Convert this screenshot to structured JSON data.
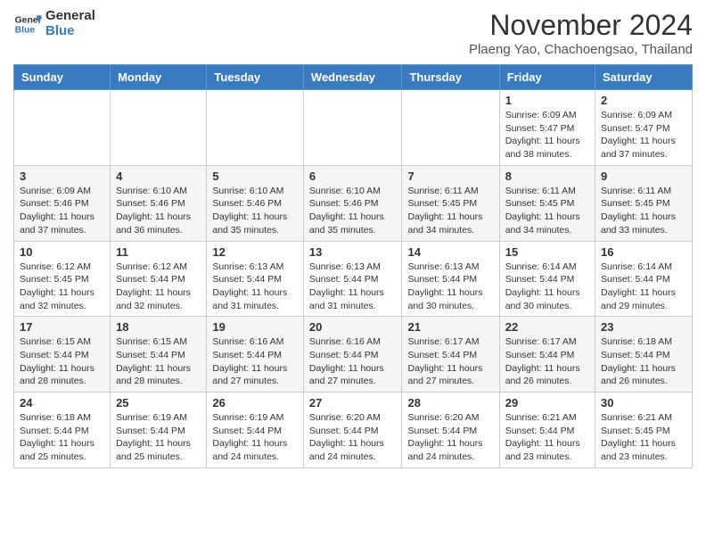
{
  "header": {
    "logo_line1": "General",
    "logo_line2": "Blue",
    "month": "November 2024",
    "location": "Plaeng Yao, Chachoengsao, Thailand"
  },
  "weekdays": [
    "Sunday",
    "Monday",
    "Tuesday",
    "Wednesday",
    "Thursday",
    "Friday",
    "Saturday"
  ],
  "weeks": [
    [
      {
        "day": "",
        "info": ""
      },
      {
        "day": "",
        "info": ""
      },
      {
        "day": "",
        "info": ""
      },
      {
        "day": "",
        "info": ""
      },
      {
        "day": "",
        "info": ""
      },
      {
        "day": "1",
        "info": "Sunrise: 6:09 AM\nSunset: 5:47 PM\nDaylight: 11 hours\nand 38 minutes."
      },
      {
        "day": "2",
        "info": "Sunrise: 6:09 AM\nSunset: 5:47 PM\nDaylight: 11 hours\nand 37 minutes."
      }
    ],
    [
      {
        "day": "3",
        "info": "Sunrise: 6:09 AM\nSunset: 5:46 PM\nDaylight: 11 hours\nand 37 minutes."
      },
      {
        "day": "4",
        "info": "Sunrise: 6:10 AM\nSunset: 5:46 PM\nDaylight: 11 hours\nand 36 minutes."
      },
      {
        "day": "5",
        "info": "Sunrise: 6:10 AM\nSunset: 5:46 PM\nDaylight: 11 hours\nand 35 minutes."
      },
      {
        "day": "6",
        "info": "Sunrise: 6:10 AM\nSunset: 5:46 PM\nDaylight: 11 hours\nand 35 minutes."
      },
      {
        "day": "7",
        "info": "Sunrise: 6:11 AM\nSunset: 5:45 PM\nDaylight: 11 hours\nand 34 minutes."
      },
      {
        "day": "8",
        "info": "Sunrise: 6:11 AM\nSunset: 5:45 PM\nDaylight: 11 hours\nand 34 minutes."
      },
      {
        "day": "9",
        "info": "Sunrise: 6:11 AM\nSunset: 5:45 PM\nDaylight: 11 hours\nand 33 minutes."
      }
    ],
    [
      {
        "day": "10",
        "info": "Sunrise: 6:12 AM\nSunset: 5:45 PM\nDaylight: 11 hours\nand 32 minutes."
      },
      {
        "day": "11",
        "info": "Sunrise: 6:12 AM\nSunset: 5:44 PM\nDaylight: 11 hours\nand 32 minutes."
      },
      {
        "day": "12",
        "info": "Sunrise: 6:13 AM\nSunset: 5:44 PM\nDaylight: 11 hours\nand 31 minutes."
      },
      {
        "day": "13",
        "info": "Sunrise: 6:13 AM\nSunset: 5:44 PM\nDaylight: 11 hours\nand 31 minutes."
      },
      {
        "day": "14",
        "info": "Sunrise: 6:13 AM\nSunset: 5:44 PM\nDaylight: 11 hours\nand 30 minutes."
      },
      {
        "day": "15",
        "info": "Sunrise: 6:14 AM\nSunset: 5:44 PM\nDaylight: 11 hours\nand 30 minutes."
      },
      {
        "day": "16",
        "info": "Sunrise: 6:14 AM\nSunset: 5:44 PM\nDaylight: 11 hours\nand 29 minutes."
      }
    ],
    [
      {
        "day": "17",
        "info": "Sunrise: 6:15 AM\nSunset: 5:44 PM\nDaylight: 11 hours\nand 28 minutes."
      },
      {
        "day": "18",
        "info": "Sunrise: 6:15 AM\nSunset: 5:44 PM\nDaylight: 11 hours\nand 28 minutes."
      },
      {
        "day": "19",
        "info": "Sunrise: 6:16 AM\nSunset: 5:44 PM\nDaylight: 11 hours\nand 27 minutes."
      },
      {
        "day": "20",
        "info": "Sunrise: 6:16 AM\nSunset: 5:44 PM\nDaylight: 11 hours\nand 27 minutes."
      },
      {
        "day": "21",
        "info": "Sunrise: 6:17 AM\nSunset: 5:44 PM\nDaylight: 11 hours\nand 27 minutes."
      },
      {
        "day": "22",
        "info": "Sunrise: 6:17 AM\nSunset: 5:44 PM\nDaylight: 11 hours\nand 26 minutes."
      },
      {
        "day": "23",
        "info": "Sunrise: 6:18 AM\nSunset: 5:44 PM\nDaylight: 11 hours\nand 26 minutes."
      }
    ],
    [
      {
        "day": "24",
        "info": "Sunrise: 6:18 AM\nSunset: 5:44 PM\nDaylight: 11 hours\nand 25 minutes."
      },
      {
        "day": "25",
        "info": "Sunrise: 6:19 AM\nSunset: 5:44 PM\nDaylight: 11 hours\nand 25 minutes."
      },
      {
        "day": "26",
        "info": "Sunrise: 6:19 AM\nSunset: 5:44 PM\nDaylight: 11 hours\nand 24 minutes."
      },
      {
        "day": "27",
        "info": "Sunrise: 6:20 AM\nSunset: 5:44 PM\nDaylight: 11 hours\nand 24 minutes."
      },
      {
        "day": "28",
        "info": "Sunrise: 6:20 AM\nSunset: 5:44 PM\nDaylight: 11 hours\nand 24 minutes."
      },
      {
        "day": "29",
        "info": "Sunrise: 6:21 AM\nSunset: 5:44 PM\nDaylight: 11 hours\nand 23 minutes."
      },
      {
        "day": "30",
        "info": "Sunrise: 6:21 AM\nSunset: 5:45 PM\nDaylight: 11 hours\nand 23 minutes."
      }
    ]
  ]
}
